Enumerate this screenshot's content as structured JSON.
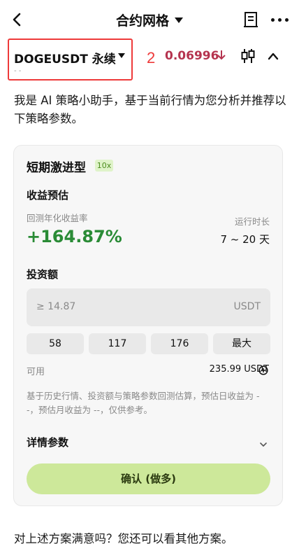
{
  "header": {
    "back_icon": "chevron-left-icon",
    "title": "合约网格",
    "doc_icon": "document-icon",
    "more_icon": "more-horizontal-icon"
  },
  "market": {
    "symbol": "DOGEUSDT 永续",
    "sub": "- -",
    "annotation_number": "2",
    "price": "0.06996",
    "price_direction_icon": "arrow-down-icon",
    "price_color": "#b5344f",
    "kline_icon": "candlestick-icon",
    "collapse_icon": "chevron-up-icon"
  },
  "intro_text": "我是 AI 策略小助手，基于当前行情为您分析并推荐以下策略参数。",
  "strategy": {
    "name": "短期激进型",
    "leverage": "10x",
    "earnings_title": "收益预估",
    "annual_label": "回测年化收益率",
    "annual_value": "+164.87%",
    "annual_color": "#2a8b36",
    "runtime_label": "运行时长",
    "runtime_value": "7 ~ 20 天",
    "investment_title": "投资额",
    "investment_placeholder": "≥ 14.87",
    "investment_unit": "USDT",
    "quick_amounts": [
      "58",
      "117",
      "176",
      "最大"
    ],
    "available_label": "可用",
    "available_value": "235.99 USDT",
    "disclaimer": "基于历史行情、投资额与策略参数回测估算，预估日收益为 --，预估月收益为 --，仅供参考。",
    "details_label": "详情参数",
    "confirm_label": "确认 (做多)",
    "accent_color": "#cde89a"
  },
  "footer_text": "对上述方案满意吗？您还可以看其他方案。"
}
